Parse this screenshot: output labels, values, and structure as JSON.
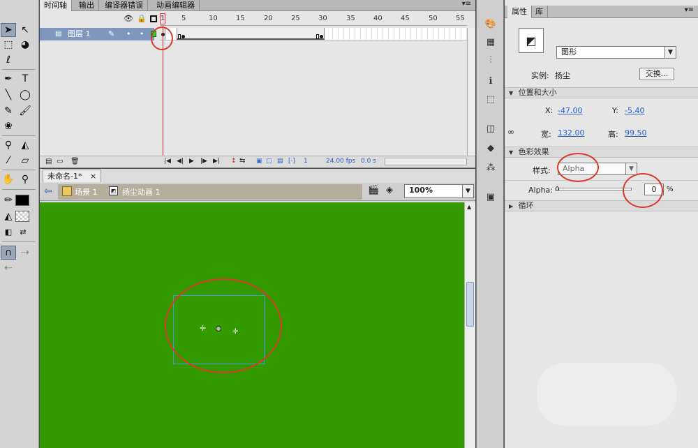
{
  "timeline": {
    "tabs": [
      "时间轴",
      "输出",
      "编译器错误",
      "动画编辑器"
    ],
    "layer_name": "图层 1",
    "ruler_numbers": [
      "1",
      "5",
      "10",
      "15",
      "20",
      "25",
      "30",
      "35",
      "40",
      "45",
      "50",
      "55"
    ],
    "bottom": {
      "frame": "1",
      "fps": "24.00 fps",
      "time": "0.0 s"
    }
  },
  "document": {
    "tab": "未命名-1*",
    "close": "×",
    "breadcrumb": {
      "scene": "场景 1",
      "symbol": "扬尘动画 1"
    },
    "zoom": "100%"
  },
  "properties": {
    "tabs": [
      "属性",
      "库"
    ],
    "type_select": "图形",
    "instance_label": "实例:",
    "instance_name": "扬尘",
    "swap_button": "交换...",
    "sections": {
      "position": "位置和大小",
      "color": "色彩效果",
      "loop": "循环"
    },
    "x_label": "X:",
    "x_value": "-47.00",
    "y_label": "Y:",
    "y_value": "-5.40",
    "w_label": "宽:",
    "w_value": "132.00",
    "h_label": "高:",
    "h_value": "99.50",
    "style_label": "样式:",
    "style_value": "Alpha",
    "alpha_label": "Alpha:",
    "alpha_value": "0",
    "alpha_unit": "%",
    "alpha_slider_fraction": 0
  },
  "colors": {
    "stage": "#339a00",
    "layer_selected": "#7f97bf",
    "annotation": "#d93a2b"
  }
}
